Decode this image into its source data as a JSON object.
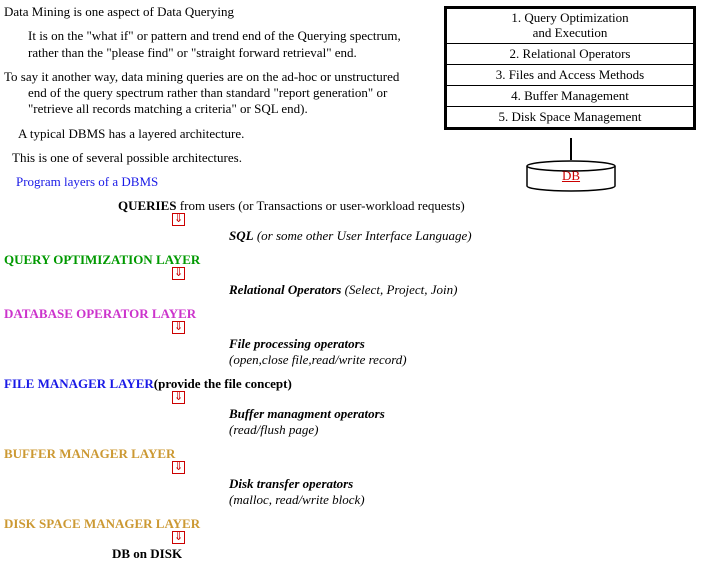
{
  "intro": {
    "line1": "Data Mining is one aspect of Data Querying",
    "line2": "It is on the \"what if\" or pattern and trend end of  the Querying spectrum,",
    "line3": "rather than the \"please find\" or \"straight forward retrieval\" end.",
    "line4": "To say it another way, data mining queries are on the ad-hoc or unstructured",
    "line5": "end of the query spectrum rather than standard \"report generation\" or",
    "line6": "\"retrieve all records matching a criteria\" or SQL end).",
    "line7": "A typical DBMS has a layered architecture.",
    "line8": "This is one of several possible architectures.",
    "line9": "Program layers of a DBMS"
  },
  "box": {
    "r1a": "1. Query Optimization",
    "r1b": "and Execution",
    "r2": "2. Relational Operators",
    "r3": "3. Files and Access Methods",
    "r4": "4. Buffer Management",
    "r5": "5. Disk Space Management"
  },
  "db": {
    "label": "DB"
  },
  "layers": {
    "q_left": "QUERIES",
    "q_right": " from users (or Transactions or user-workload requests)",
    "q_sub": "SQL",
    "q_sub2": " (or some other User Interface Language)",
    "l1": "QUERY OPTIMIZATION LAYER",
    "l1_sub": "Relational Operators",
    "l1_sub2": " (Select, Project, Join)",
    "l2": "DATABASE OPERATOR LAYER",
    "l2_sub": "File processing operators",
    "l2_sub2": "(open,close file,read/write record)",
    "l3": "FILE MANAGER LAYER",
    "l3b": " (provide the file concept)",
    "l3_sub": "Buffer managment operators",
    "l3_sub2": "(read/flush page)",
    "l4": "BUFFER MANAGER LAYER",
    "l4_sub": "Disk transfer operators",
    "l4_sub2": "(malloc, read/write block)",
    "l5": "DISK SPACE MANAGER LAYER",
    "l6": "DB on DISK"
  }
}
